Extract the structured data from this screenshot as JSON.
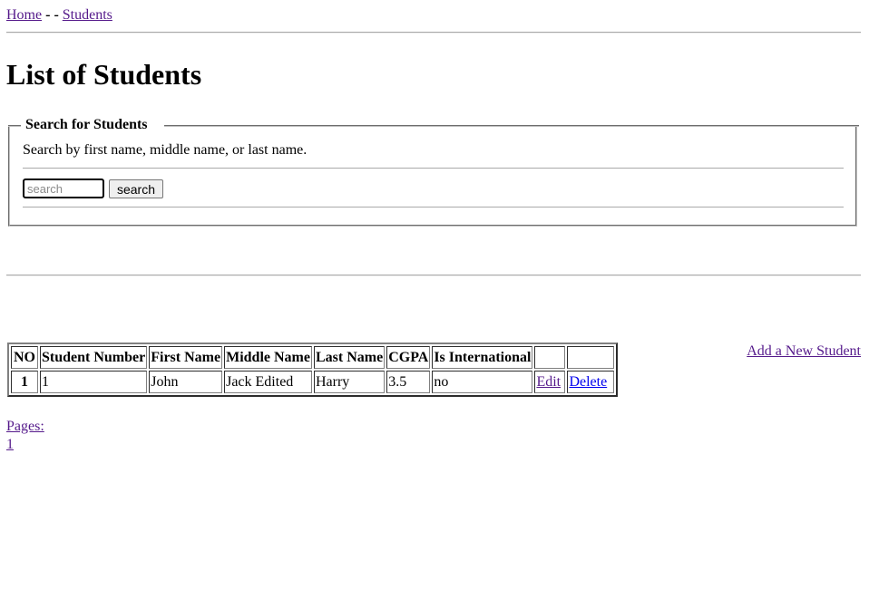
{
  "breadcrumb": {
    "home": "Home",
    "separator": "- -",
    "current": "Students"
  },
  "page_title": "List of Students",
  "search": {
    "legend": "Search for Students",
    "description": "Search by first name, middle name, or last name.",
    "placeholder": "search",
    "value": "",
    "button_label": "search"
  },
  "add_link": "Add a New Student",
  "table": {
    "headers": [
      "NO",
      "Student Number",
      "First Name",
      "Middle Name",
      "Last Name",
      "CGPA",
      "Is International",
      "",
      ""
    ],
    "rows": [
      {
        "no": "1",
        "student_number": "1",
        "first_name": "John",
        "middle_name": "Jack Edited",
        "last_name": "Harry",
        "cgpa": "3.5",
        "is_international": "no",
        "edit": "Edit",
        "delete": "Delete"
      }
    ]
  },
  "pagination": {
    "label": "Pages:",
    "pages": [
      "1"
    ]
  },
  "colors": {
    "visited_link": "#551a8b",
    "link": "#0000ee"
  }
}
